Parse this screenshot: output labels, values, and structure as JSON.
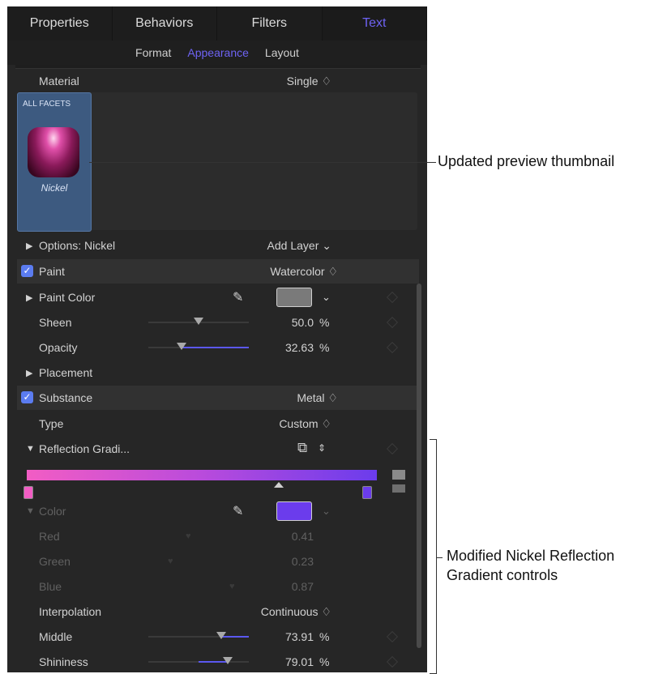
{
  "tabs": [
    "Properties",
    "Behaviors",
    "Filters",
    "Text"
  ],
  "subtabs": [
    "Format",
    "Appearance",
    "Layout"
  ],
  "material": {
    "label": "Material",
    "value": "Single ♢"
  },
  "thumbnail": {
    "caption": "ALL FACETS",
    "name": "Nickel"
  },
  "options": {
    "label": "Options: Nickel",
    "value": "Add Layer ⌄"
  },
  "paint": {
    "label": "Paint",
    "value": "Watercolor ♢"
  },
  "paint_color": {
    "label": "Paint Color"
  },
  "sheen": {
    "label": "Sheen",
    "value": "50.0",
    "unit": "%",
    "level": 0.5
  },
  "opacity": {
    "label": "Opacity",
    "value": "32.63",
    "unit": "%",
    "level": 0.33
  },
  "placement": {
    "label": "Placement"
  },
  "substance": {
    "label": "Substance",
    "value": "Metal ♢"
  },
  "type": {
    "label": "Type",
    "value": "Custom ♢"
  },
  "reflection": {
    "label": "Reflection Gradi..."
  },
  "color": {
    "label": "Color",
    "swatch": "#6b3cec"
  },
  "red": {
    "label": "Red",
    "value": "0.41",
    "level": 0.41
  },
  "green": {
    "label": "Green",
    "value": "0.23",
    "level": 0.23
  },
  "blue": {
    "label": "Blue",
    "value": "0.87",
    "level": 0.87
  },
  "interpolation": {
    "label": "Interpolation",
    "value": "Continuous ♢"
  },
  "middle": {
    "label": "Middle",
    "value": "73.91",
    "unit": "%",
    "level": 0.74
  },
  "shininess": {
    "label": "Shininess",
    "value": "79.01",
    "unit": "%",
    "level": 0.79
  },
  "annotations": {
    "preview": "Updated preview thumbnail",
    "gradient_line1": "Modified Nickel Reflection",
    "gradient_line2": "Gradient controls"
  },
  "colors": {
    "accent": "#6e63f3",
    "checkbox": "#5b7cf0",
    "gradient_start": "#f25dc4",
    "gradient_end": "#6b3cec"
  }
}
